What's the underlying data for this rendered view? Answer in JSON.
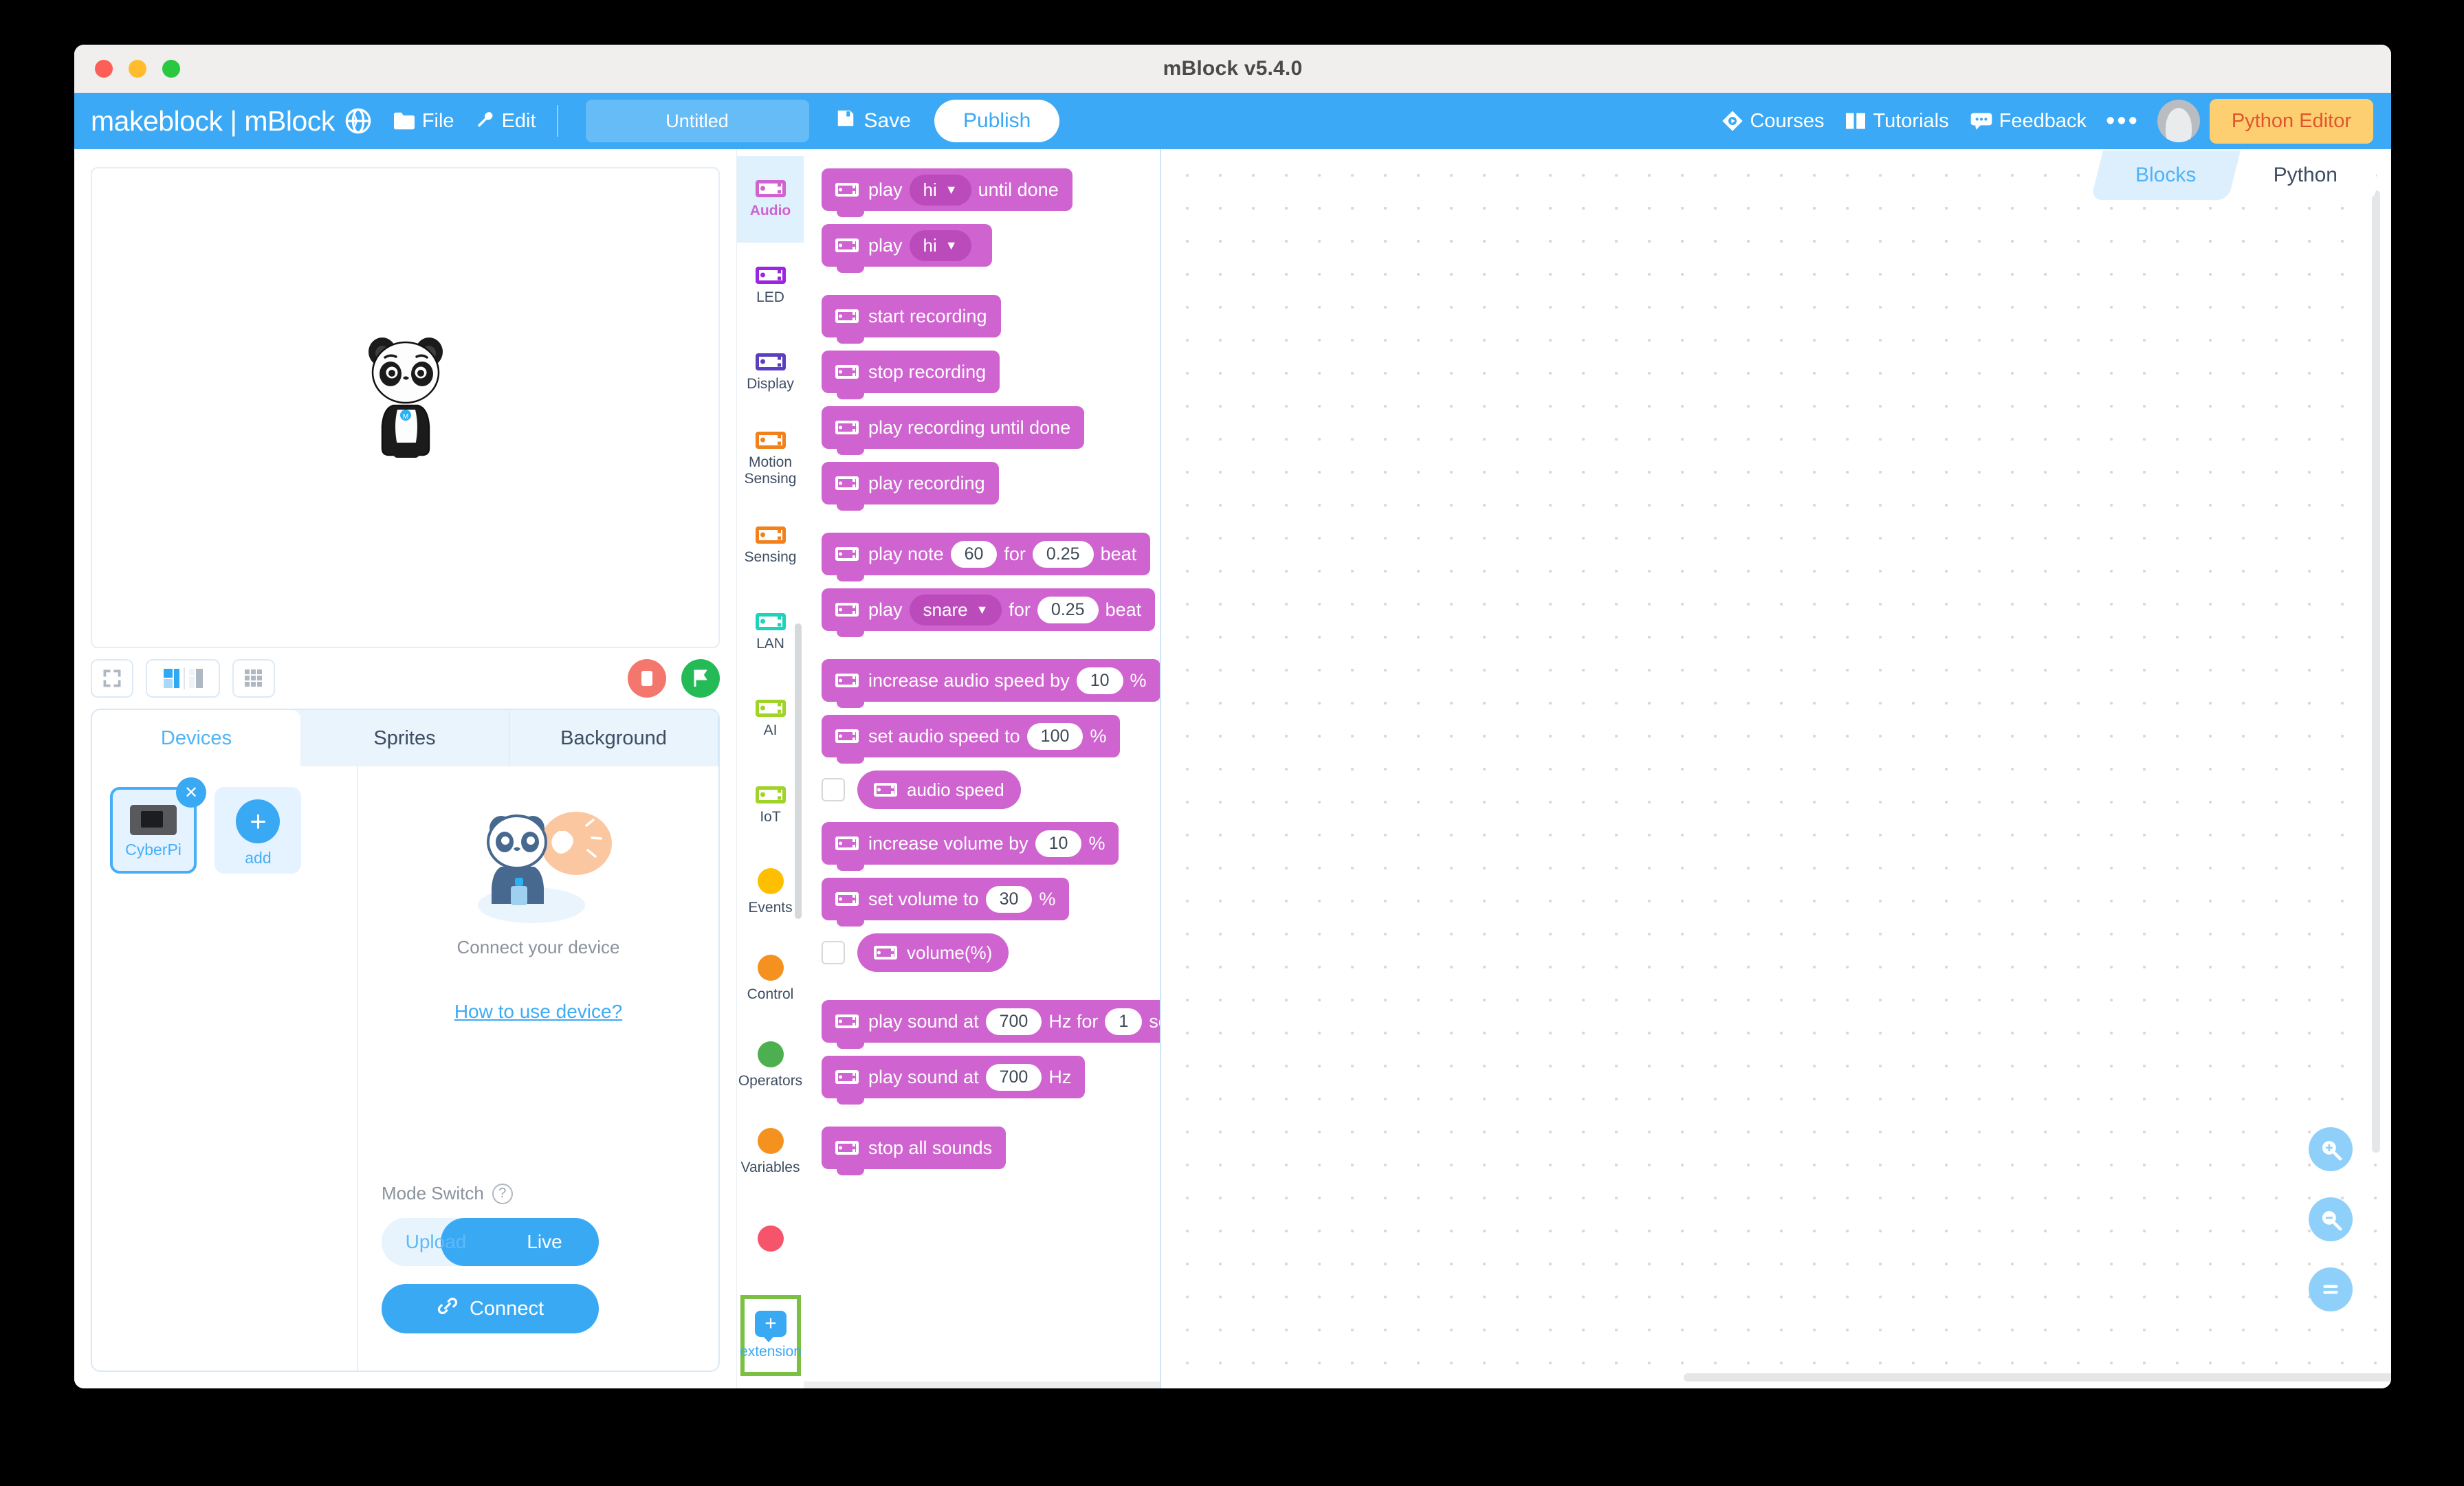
{
  "window": {
    "title": "mBlock v5.4.0"
  },
  "topbar": {
    "brand": "makeblock | mBlock",
    "file_label": "File",
    "edit_label": "Edit",
    "project_name": "Untitled",
    "save_label": "Save",
    "publish_label": "Publish",
    "courses_label": "Courses",
    "tutorials_label": "Tutorials",
    "feedback_label": "Feedback",
    "more_label": "•••",
    "python_editor_label": "Python Editor",
    "accent_color": "#3ba9f5",
    "python_btn_color": "#fdcf70"
  },
  "stage": {
    "sprite_name": "Panda",
    "tools": [
      "fullscreen-layout",
      "split-layout",
      "grid-layout"
    ],
    "stop_label": "stop",
    "run_label": "run"
  },
  "panel": {
    "tabs": [
      {
        "label": "Devices",
        "active": true
      },
      {
        "label": "Sprites",
        "active": false
      },
      {
        "label": "Background",
        "active": false
      }
    ],
    "devices": [
      {
        "label": "CyberPi",
        "selected": true
      },
      {
        "label": "add",
        "selected": false
      }
    ],
    "connect_text": "Connect your device",
    "howto_label": "How to use device?",
    "mode_switch_label": "Mode Switch",
    "mode_options": [
      {
        "label": "Upload",
        "active": false
      },
      {
        "label": "Live",
        "active": true
      }
    ],
    "connect_label": "Connect"
  },
  "categories": [
    {
      "label": "Audio",
      "color": "#cf63cf",
      "shape": "board",
      "active": true
    },
    {
      "label": "LED",
      "color": "#9b25e0",
      "shape": "board",
      "active": false
    },
    {
      "label": "Display",
      "color": "#5b3fbf",
      "shape": "board",
      "active": false
    },
    {
      "label": "Motion\nSensing",
      "color": "#f2801b",
      "shape": "board",
      "active": false
    },
    {
      "label": "Sensing",
      "color": "#f2801b",
      "shape": "board",
      "active": false
    },
    {
      "label": "LAN",
      "color": "#1fd2ba",
      "shape": "board",
      "active": false
    },
    {
      "label": "AI",
      "color": "#9fd325",
      "shape": "board",
      "active": false
    },
    {
      "label": "IoT",
      "color": "#9fd325",
      "shape": "board",
      "active": false
    },
    {
      "label": "Events",
      "color": "#ffbf00",
      "shape": "dot",
      "active": false
    },
    {
      "label": "Control",
      "color": "#f5921f",
      "shape": "dot",
      "active": false
    },
    {
      "label": "Operators",
      "color": "#4cb050",
      "shape": "dot",
      "active": false
    },
    {
      "label": "Variables",
      "color": "#f5921f",
      "shape": "dot",
      "active": false
    },
    {
      "label": "",
      "color": "#f5546b",
      "shape": "dot",
      "active": false
    }
  ],
  "extension": {
    "label": "extension",
    "icon": "plus-icon",
    "highlight_color": "#7ac143"
  },
  "palette": {
    "category": "Audio",
    "block_color": "#cf63cf",
    "blocks": [
      {
        "type": "stack",
        "parts": [
          {
            "k": "icon"
          },
          {
            "k": "text",
            "v": "play"
          },
          {
            "k": "dropdown",
            "v": "hi"
          },
          {
            "k": "text",
            "v": "until done"
          }
        ]
      },
      {
        "type": "stack",
        "parts": [
          {
            "k": "icon"
          },
          {
            "k": "text",
            "v": "play"
          },
          {
            "k": "dropdown",
            "v": "hi"
          }
        ],
        "gap_after": true
      },
      {
        "type": "stack",
        "parts": [
          {
            "k": "icon"
          },
          {
            "k": "text",
            "v": "start recording"
          }
        ]
      },
      {
        "type": "stack",
        "parts": [
          {
            "k": "icon"
          },
          {
            "k": "text",
            "v": "stop recording"
          }
        ]
      },
      {
        "type": "stack",
        "parts": [
          {
            "k": "icon"
          },
          {
            "k": "text",
            "v": "play recording until done"
          }
        ]
      },
      {
        "type": "stack",
        "parts": [
          {
            "k": "icon"
          },
          {
            "k": "text",
            "v": "play recording"
          }
        ],
        "gap_after": true
      },
      {
        "type": "stack",
        "parts": [
          {
            "k": "icon"
          },
          {
            "k": "text",
            "v": "play note"
          },
          {
            "k": "input",
            "v": "60"
          },
          {
            "k": "text",
            "v": "for"
          },
          {
            "k": "input",
            "v": "0.25"
          },
          {
            "k": "text",
            "v": "beat"
          }
        ]
      },
      {
        "type": "stack",
        "parts": [
          {
            "k": "icon"
          },
          {
            "k": "text",
            "v": "play"
          },
          {
            "k": "dropdown",
            "v": "snare"
          },
          {
            "k": "text",
            "v": "for"
          },
          {
            "k": "input",
            "v": "0.25"
          },
          {
            "k": "text",
            "v": "beat"
          }
        ],
        "gap_after": true
      },
      {
        "type": "stack",
        "parts": [
          {
            "k": "icon"
          },
          {
            "k": "text",
            "v": "increase audio speed by"
          },
          {
            "k": "input",
            "v": "10"
          },
          {
            "k": "text",
            "v": "%"
          }
        ]
      },
      {
        "type": "stack",
        "parts": [
          {
            "k": "icon"
          },
          {
            "k": "text",
            "v": "set audio speed to"
          },
          {
            "k": "input",
            "v": "100"
          },
          {
            "k": "text",
            "v": "%"
          }
        ]
      },
      {
        "type": "reporter",
        "checkbox": false,
        "parts": [
          {
            "k": "icon"
          },
          {
            "k": "text",
            "v": "audio speed"
          }
        ]
      },
      {
        "type": "stack",
        "parts": [
          {
            "k": "icon"
          },
          {
            "k": "text",
            "v": "increase volume by"
          },
          {
            "k": "input",
            "v": "10"
          },
          {
            "k": "text",
            "v": "%"
          }
        ]
      },
      {
        "type": "stack",
        "parts": [
          {
            "k": "icon"
          },
          {
            "k": "text",
            "v": "set volume to"
          },
          {
            "k": "input",
            "v": "30"
          },
          {
            "k": "text",
            "v": "%"
          }
        ]
      },
      {
        "type": "reporter",
        "checkbox": false,
        "parts": [
          {
            "k": "icon"
          },
          {
            "k": "text",
            "v": "volume(%)"
          }
        ],
        "gap_after": true
      },
      {
        "type": "stack",
        "parts": [
          {
            "k": "icon"
          },
          {
            "k": "text",
            "v": "play sound at"
          },
          {
            "k": "input",
            "v": "700"
          },
          {
            "k": "text",
            "v": "Hz for"
          },
          {
            "k": "input",
            "v": "1"
          },
          {
            "k": "text",
            "v": "sec"
          }
        ]
      },
      {
        "type": "stack",
        "parts": [
          {
            "k": "icon"
          },
          {
            "k": "text",
            "v": "play sound at"
          },
          {
            "k": "input",
            "v": "700"
          },
          {
            "k": "text",
            "v": "Hz"
          }
        ],
        "gap_after": true
      },
      {
        "type": "stack",
        "parts": [
          {
            "k": "icon"
          },
          {
            "k": "text",
            "v": "stop all sounds"
          }
        ]
      }
    ]
  },
  "code_area": {
    "mode_tabs": [
      {
        "label": "Blocks",
        "active": true
      },
      {
        "label": "Python",
        "active": false
      }
    ],
    "zoom_controls": [
      "zoom-in-icon",
      "zoom-out-icon",
      "zoom-reset-icon"
    ]
  }
}
